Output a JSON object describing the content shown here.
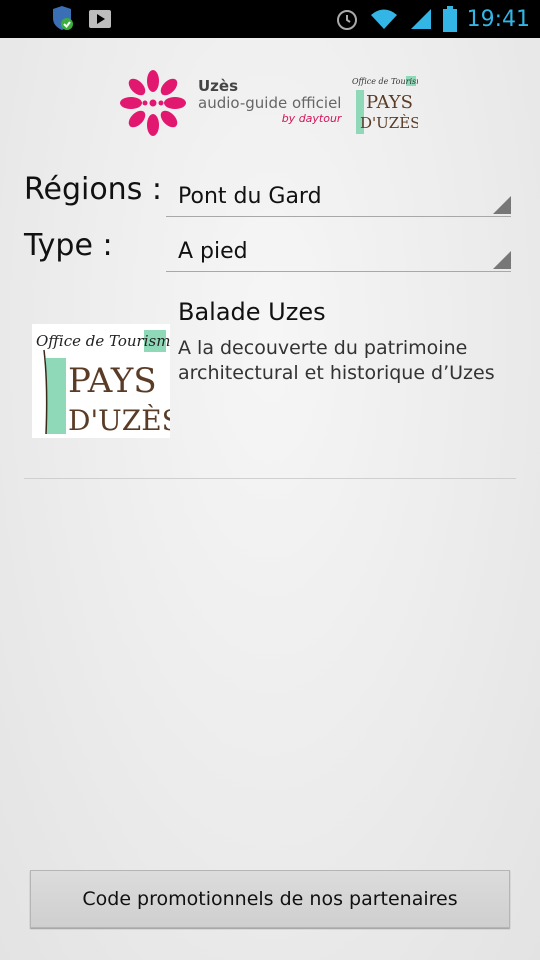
{
  "status_bar": {
    "time": "19:41",
    "icons": [
      "shield-check-icon",
      "play-store-icon",
      "alarm-icon",
      "wifi-icon",
      "signal-icon",
      "battery-icon"
    ],
    "accent_color": "#33b5e5"
  },
  "header": {
    "city": "Uzès",
    "subtitle": "audio-guide officiel",
    "by_prefix": "by ",
    "by_brand": "daytour",
    "partner_logo_alt": [
      "Office de Tourisme",
      "PAYS",
      "D'UZÈS"
    ],
    "brand_color": "#e2176f"
  },
  "filters": {
    "regions": {
      "label": "Régions :",
      "value": "Pont du Gard"
    },
    "type": {
      "label": "Type :",
      "value": "A pied"
    }
  },
  "list": {
    "items": [
      {
        "title": "Balade Uzes",
        "description": "A la decouverte du patrimoine architectural et historique d’Uzes",
        "logo_text": [
          "Office de Tourisme",
          "PAYS",
          "D'UZÈS"
        ]
      }
    ]
  },
  "footer": {
    "promo_button": "Code promotionnels de nos partenaires"
  }
}
